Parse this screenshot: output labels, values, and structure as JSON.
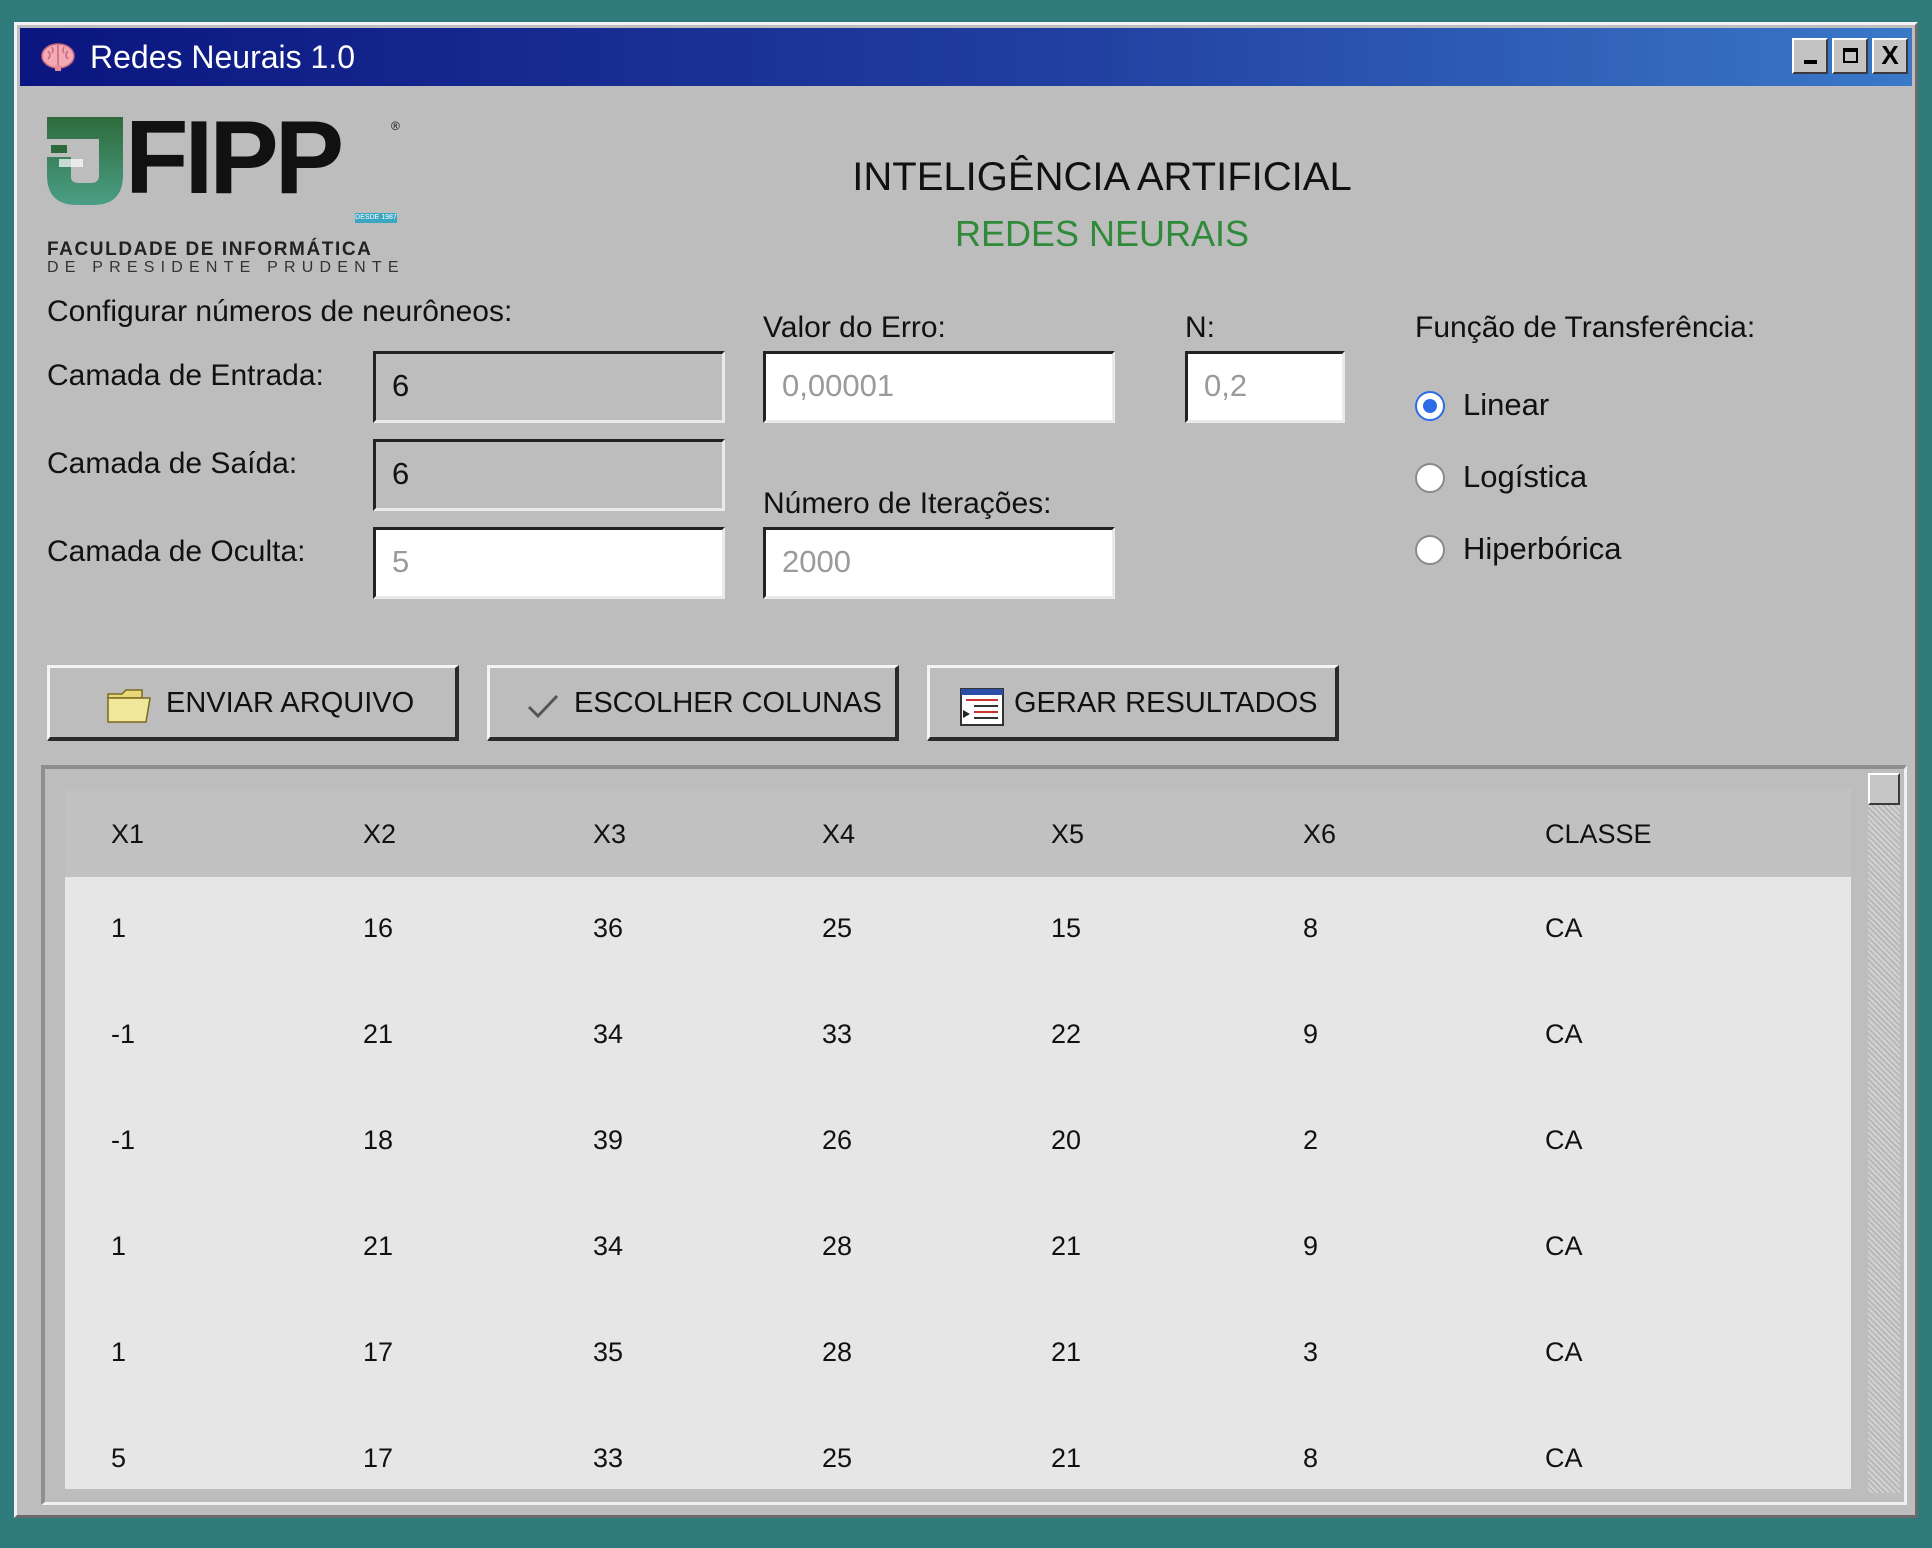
{
  "window": {
    "title": "Redes Neurais 1.0",
    "close_label": "X"
  },
  "logo": {
    "name": "FIPP",
    "line1": "FACULDADE DE INFORMÁTICA",
    "line2": "DE PRESIDENTE PRUDENTE",
    "desde": "DESDE 1987",
    "reg": "®"
  },
  "header": {
    "title": "INTELIGÊNCIA ARTIFICIAL",
    "subtitle": "REDES NEURAIS"
  },
  "config": {
    "heading": "Configurar números de neurôneos:",
    "entrada_label": "Camada de Entrada:",
    "entrada_value": "6",
    "saida_label": "Camada de Saída:",
    "saida_value": "6",
    "oculta_label": "Camada de Oculta:",
    "oculta_value": "5"
  },
  "erro": {
    "label": "Valor do Erro:",
    "value": "0,00001"
  },
  "n": {
    "label": "N:",
    "value": "0,2"
  },
  "iteracoes": {
    "label": "Número de Iterações:",
    "value": "2000"
  },
  "transferencia": {
    "label": "Função de Transferência:",
    "options": [
      "Linear",
      "Logística",
      "Hiperbórica"
    ],
    "selected": "Linear"
  },
  "buttons": {
    "enviar": "ENVIAR ARQUIVO",
    "escolher": "ESCOLHER COLUNAS",
    "gerar": "GERAR RESULTADOS"
  },
  "colors": {
    "accent_green": "#2f8a3a",
    "titlebar_start": "#0b1580",
    "titlebar_end": "#3a78c8",
    "radio_blue": "#2e6be6",
    "desktop": "#2f7b7c"
  },
  "table": {
    "columns": [
      "X1",
      "X2",
      "X3",
      "X4",
      "X5",
      "X6",
      "CLASSE"
    ],
    "rows": [
      [
        "1",
        "16",
        "36",
        "25",
        "15",
        "8",
        "CA"
      ],
      [
        "-1",
        "21",
        "34",
        "33",
        "22",
        "9",
        "CA"
      ],
      [
        "-1",
        "18",
        "39",
        "26",
        "20",
        "2",
        "CA"
      ],
      [
        "1",
        "21",
        "34",
        "28",
        "21",
        "9",
        "CA"
      ],
      [
        "1",
        "17",
        "35",
        "28",
        "21",
        "3",
        "CA"
      ],
      [
        "5",
        "17",
        "33",
        "25",
        "21",
        "8",
        "CA"
      ]
    ]
  }
}
